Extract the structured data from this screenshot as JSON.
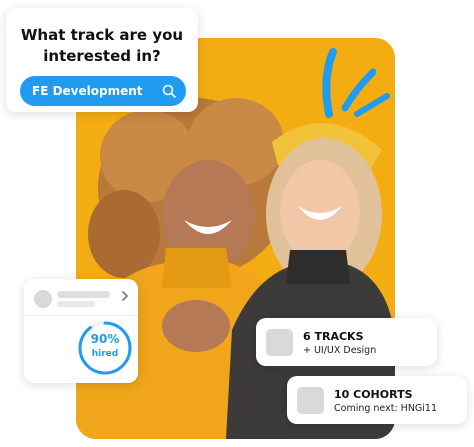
{
  "search": {
    "title": "What track are you interested in?",
    "selected_track": "FE Development",
    "icon": "search-icon"
  },
  "stats": {
    "percent": "90%",
    "label": "hired",
    "fill_fraction": 0.9,
    "icon": "chevron-right-icon"
  },
  "tracks": {
    "title": "6 TRACKS",
    "subtitle": "+ UI/UX Design"
  },
  "cohorts": {
    "title": "10 COHORTS",
    "subtitle": "Coming next: HNGi11"
  },
  "colors": {
    "accent": "#1f9bf0",
    "photo_background": "#f3ad12"
  }
}
